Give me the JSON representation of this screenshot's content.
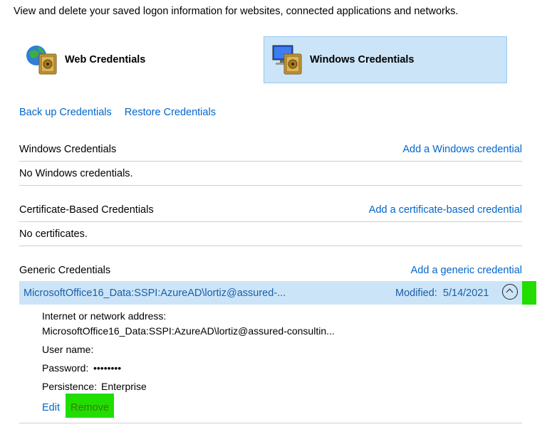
{
  "description": "View and delete your saved logon information for websites, connected applications and networks.",
  "categories": {
    "web": {
      "label": "Web Credentials",
      "icon": "web-credentials-vault-icon"
    },
    "windows": {
      "label": "Windows Credentials",
      "icon": "windows-credentials-vault-icon",
      "selected": true
    }
  },
  "links": {
    "backup": "Back up Credentials",
    "restore": "Restore Credentials"
  },
  "sections": {
    "windows": {
      "title": "Windows Credentials",
      "add": "Add a Windows credential",
      "empty": "No Windows credentials."
    },
    "certificate": {
      "title": "Certificate-Based Credentials",
      "add": "Add a certificate-based credential",
      "empty": "No certificates."
    },
    "generic": {
      "title": "Generic Credentials",
      "add": "Add a generic credential"
    }
  },
  "credential": {
    "name": "MicrosoftOffice16_Data:SSPI:AzureAD\\lortiz@assured-...",
    "modified_label": "Modified:",
    "modified_date": "5/14/2021",
    "address_label": "Internet or network address:",
    "address_value": "MicrosoftOffice16_Data:SSPI:AzureAD\\lortiz@assured-consultin...",
    "username_label": "User name:",
    "username_value": "",
    "password_label": "Password:",
    "password_value": "••••••••",
    "persistence_label": "Persistence:",
    "persistence_value": "Enterprise",
    "edit": "Edit",
    "remove": "Remove"
  },
  "colors": {
    "link": "#0066cc",
    "selected_bg": "#cce4f7",
    "highlight": "#22dd00"
  }
}
